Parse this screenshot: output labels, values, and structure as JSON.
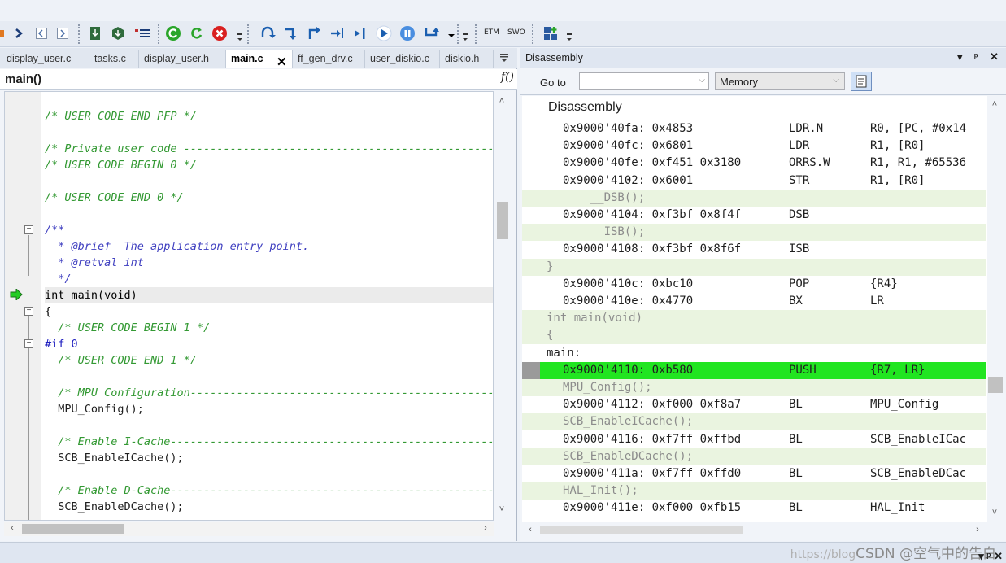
{
  "toolbar": {
    "etm": "ETM",
    "swo": "SWO"
  },
  "editor": {
    "tabs": [
      {
        "label": "display_user.c",
        "active": false
      },
      {
        "label": "tasks.c",
        "active": false
      },
      {
        "label": "display_user.h",
        "active": false
      },
      {
        "label": "main.c",
        "active": true
      },
      {
        "label": "ff_gen_drv.c",
        "active": false
      },
      {
        "label": "user_diskio.c",
        "active": false
      },
      {
        "label": "diskio.h",
        "active": false
      }
    ],
    "function_name": "main()",
    "fx_label": "f()",
    "code_lines": [
      "/* USER CODE END PFP */",
      "",
      "/* Private user code ---------------------------------------------------------",
      "/* USER CODE BEGIN 0 */",
      "",
      "/* USER CODE END 0 */",
      "",
      "/**",
      "  * @brief  The application entry point.",
      "  * @retval int",
      "  */",
      "int main(void)",
      "{",
      "  /* USER CODE BEGIN 1 */",
      "#if 0",
      "  /* USER CODE END 1 */",
      "",
      "  /* MPU Configuration--------------------------------------------------------",
      "  MPU_Config();",
      "",
      "  /* Enable I-Cache---------------------------------------------------------",
      "  SCB_EnableICache();",
      "",
      "  /* Enable D-Cache---------------------------------------------------------",
      "  SCB_EnableDCache();"
    ]
  },
  "disassembly": {
    "title": "Disassembly",
    "goto_label": "Go to",
    "goto_value": "",
    "memory_option": "Memory",
    "header": "Disassembly",
    "rows": [
      {
        "kind": "ins",
        "addr": "0x9000'40fa:",
        "code": "0x4853",
        "op": "LDR.N",
        "args": "R0, [PC, #0x14"
      },
      {
        "kind": "ins",
        "addr": "0x9000'40fc:",
        "code": "0x6801",
        "op": "LDR",
        "args": "R1, [R0]"
      },
      {
        "kind": "ins",
        "addr": "0x9000'40fe:",
        "code": "0xf451 0x3180",
        "op": "ORRS.W",
        "args": "R1, R1, #65536"
      },
      {
        "kind": "ins",
        "addr": "0x9000'4102:",
        "code": "0x6001",
        "op": "STR",
        "args": "R1, [R0]"
      },
      {
        "kind": "src",
        "text": "    __DSB();",
        "indent": true
      },
      {
        "kind": "ins",
        "addr": "0x9000'4104:",
        "code": "0xf3bf 0x8f4f",
        "op": "DSB",
        "args": ""
      },
      {
        "kind": "src",
        "text": "    __ISB();",
        "indent": true
      },
      {
        "kind": "ins",
        "addr": "0x9000'4108:",
        "code": "0xf3bf 0x8f6f",
        "op": "ISB",
        "args": ""
      },
      {
        "kind": "src",
        "text": "}",
        "indent": false
      },
      {
        "kind": "ins",
        "addr": "0x9000'410c:",
        "code": "0xbc10",
        "op": "POP",
        "args": "{R4}"
      },
      {
        "kind": "ins",
        "addr": "0x9000'410e:",
        "code": "0x4770",
        "op": "BX",
        "args": "LR"
      },
      {
        "kind": "src",
        "text": "int main(void)",
        "indent": false
      },
      {
        "kind": "src",
        "text": "{",
        "indent": false
      },
      {
        "kind": "label",
        "text": "main:"
      },
      {
        "kind": "cur",
        "addr": "0x9000'4110:",
        "code": "0xb580",
        "op": "PUSH",
        "args": "{R7, LR}"
      },
      {
        "kind": "src",
        "text": "MPU_Config();",
        "indent": true
      },
      {
        "kind": "ins",
        "addr": "0x9000'4112:",
        "code": "0xf000 0xf8a7",
        "op": "BL",
        "args": "MPU_Config"
      },
      {
        "kind": "src",
        "text": "SCB_EnableICache();",
        "indent": true
      },
      {
        "kind": "ins",
        "addr": "0x9000'4116:",
        "code": "0xf7ff 0xffbd",
        "op": "BL",
        "args": "SCB_EnableICac"
      },
      {
        "kind": "src",
        "text": "SCB_EnableDCache();",
        "indent": true
      },
      {
        "kind": "ins",
        "addr": "0x9000'411a:",
        "code": "0xf7ff 0xffd0",
        "op": "BL",
        "args": "SCB_EnableDCac"
      },
      {
        "kind": "src",
        "text": "HAL_Init();",
        "indent": true
      },
      {
        "kind": "ins",
        "addr": "0x9000'411e:",
        "code": "0xf000 0xfb15",
        "op": "BL",
        "args": "HAL_Init"
      }
    ]
  },
  "watermark": {
    "left": "https://blog",
    "right": "CSDN @空气中的告白"
  },
  "colors": {
    "current_line": "#21e521",
    "source_line_bg": "#eaf4e0",
    "comment": "#339933"
  }
}
